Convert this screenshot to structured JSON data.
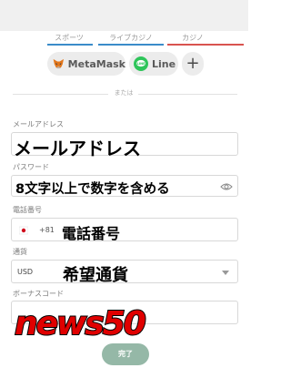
{
  "tabs": [
    "スポーツ",
    "ライブカジノ",
    "カジノ"
  ],
  "social": {
    "metamask": "MetaMask",
    "line": "Line",
    "add": "+"
  },
  "divider": "または",
  "fields": {
    "email": {
      "label": "メールアドレス",
      "value": "メールアドレス"
    },
    "password": {
      "label": "パスワード",
      "value": "8文字以上で数字を含める"
    },
    "phone": {
      "label": "電話番号",
      "country_code": "+81",
      "value": "電話番号"
    },
    "currency": {
      "label": "通貨",
      "code": "USD",
      "value": "希望通貨"
    },
    "bonus": {
      "label": "ボーナスコード",
      "value": "news50"
    }
  },
  "submit": "完了",
  "colors": {
    "tab_underline_blue": "#3a8cc9",
    "tab_underline_red": "#d9534f",
    "line_green": "#2ec55a",
    "submit_bg": "#95b8a7",
    "promo_red": "#e00000"
  }
}
